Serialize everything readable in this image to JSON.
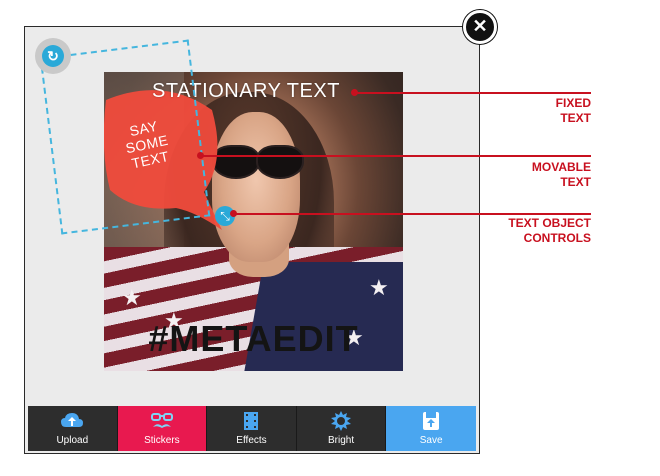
{
  "editor": {
    "photo_texts": {
      "stationary": "STATIONARY TEXT",
      "bubble_lines": [
        "SAY",
        "SOME",
        "TEXT"
      ],
      "hashtag": "#METAEDIT"
    },
    "close_icon": "close-icon",
    "rotate_icon": "rotate-icon",
    "resize_icon": "resize-icon"
  },
  "toolbar": {
    "items": [
      {
        "label": "Upload",
        "icon": "cloud-upload-icon",
        "color": "#2d2d2d"
      },
      {
        "label": "Stickers",
        "icon": "mustache-glasses-icon",
        "color": "#e8194f"
      },
      {
        "label": "Effects",
        "icon": "film-icon",
        "color": "#2d2d2d"
      },
      {
        "label": "Bright",
        "icon": "brightness-icon",
        "color": "#2d2d2d"
      },
      {
        "label": "Save",
        "icon": "save-icon",
        "color": "#4aa6f0"
      }
    ]
  },
  "callouts": [
    {
      "lines": [
        "FIXED",
        "TEXT"
      ]
    },
    {
      "lines": [
        "MOVABLE",
        "TEXT"
      ]
    },
    {
      "lines": [
        "TEXT OBJECT",
        "CONTROLS"
      ]
    }
  ],
  "colors": {
    "accent_red": "#c8101f",
    "handle_blue": "#2aa9d8",
    "stickers_pink": "#e8194f",
    "save_blue": "#4aa6f0",
    "bubble_red": "#f04b3c"
  }
}
